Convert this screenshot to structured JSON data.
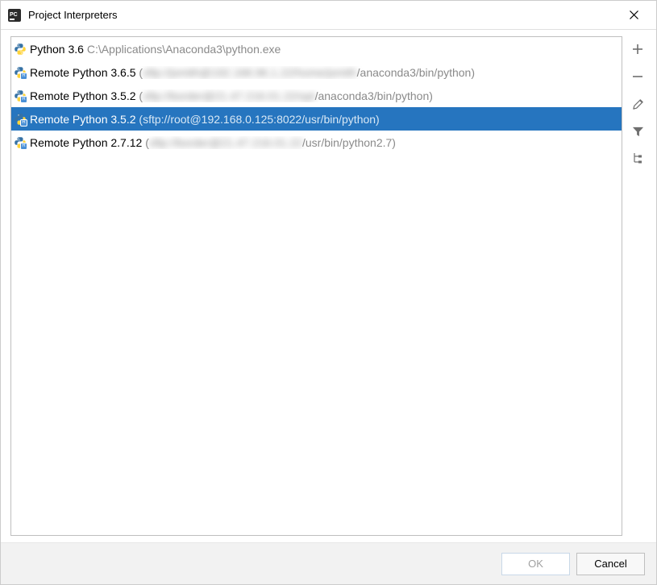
{
  "window": {
    "title": "Project Interpreters"
  },
  "interpreters": [
    {
      "name": "Python 3.6 ",
      "path": "C:\\Applications\\Anaconda3\\python.exe",
      "remote": false,
      "selected": false,
      "blurred": false
    },
    {
      "name": "Remote Python 3.6.5 ",
      "path_prefix": "(",
      "path_blurred": "sftp://jsmith@192.168.96.1.22/home/jsmith",
      "path_suffix": "/anaconda3/bin/python)",
      "remote": true,
      "selected": false,
      "blurred": true
    },
    {
      "name": "Remote Python 3.5.2 ",
      "path_prefix": "(",
      "path_blurred": "sftp://border@21.47.216.01.22/opt",
      "path_suffix": "/anaconda3/bin/python)",
      "remote": true,
      "selected": false,
      "blurred": true
    },
    {
      "name": "Remote Python 3.5.2 ",
      "path": "(sftp://root@192.168.0.125:8022/usr/bin/python)",
      "remote": true,
      "selected": true,
      "blurred": false
    },
    {
      "name": "Remote Python 2.7.12 ",
      "path_prefix": "(",
      "path_blurred": "sftp://border@21.47.216.01.22",
      "path_suffix": "/usr/bin/python2.7)",
      "remote": true,
      "selected": false,
      "blurred": true
    }
  ],
  "toolbar": {
    "add_tooltip": "Add",
    "remove_tooltip": "Remove",
    "edit_tooltip": "Edit",
    "filter_tooltip": "Filter",
    "paths_tooltip": "Show paths"
  },
  "footer": {
    "ok_label": "OK",
    "cancel_label": "Cancel"
  }
}
